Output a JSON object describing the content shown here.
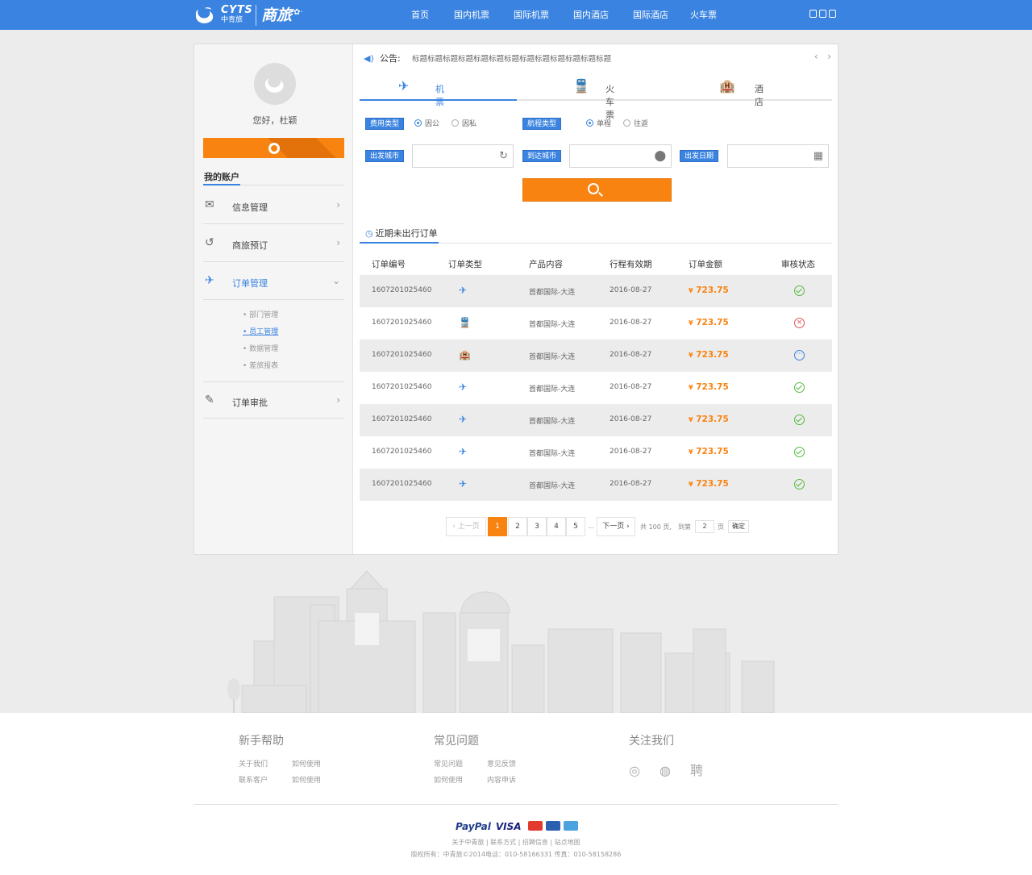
{
  "header": {
    "brand": "CYTS",
    "brand_cn": "中青旅",
    "logo_script": "商旅",
    "nav": [
      "首页",
      "国内机票",
      "国际机票",
      "国内酒店",
      "国际酒店",
      "火车票"
    ]
  },
  "sidebar": {
    "greeting": "您好，杜颖",
    "account_title": "我的账户",
    "items": [
      {
        "label": "信息管理",
        "icon": "mail-icon"
      },
      {
        "label": "商旅预订",
        "icon": "history-icon"
      },
      {
        "label": "订单管理",
        "icon": "plane-icon"
      },
      {
        "label": "订单审批",
        "icon": "edit-icon"
      }
    ],
    "submenu": [
      "部门管理",
      "员工管理",
      "数据管理",
      "差旅报表"
    ]
  },
  "notice": {
    "label": "公告:",
    "text": "标题标题标题标题标题标题标题标题标题标题标题标题标题"
  },
  "tabs": [
    "机票",
    "火车票",
    "酒店"
  ],
  "search": {
    "fee_type_label": "费用类型",
    "fee_options": [
      "因公",
      "因私"
    ],
    "trip_type_label": "航程类型",
    "trip_options": [
      "单程",
      "往返"
    ],
    "from_label": "出发城市",
    "to_label": "到达城市",
    "date_label": "出发日期"
  },
  "recent_title": "近期未出行订单",
  "table": {
    "headers": [
      "订单编号",
      "订单类型",
      "产品内容",
      "行程有效期",
      "订单金额",
      "审核状态"
    ],
    "rows": [
      {
        "id": "1607201025460",
        "type": "plane",
        "content": "首都国际-大连",
        "date": "2016-08-27",
        "amount": "723.75",
        "status": "approved"
      },
      {
        "id": "1607201025460",
        "type": "train",
        "content": "首都国际-大连",
        "date": "2016-08-27",
        "amount": "723.75",
        "status": "rejected"
      },
      {
        "id": "1607201025460",
        "type": "hotel",
        "content": "首都国际-大连",
        "date": "2016-08-27",
        "amount": "723.75",
        "status": "pending"
      },
      {
        "id": "1607201025460",
        "type": "plane",
        "content": "首都国际-大连",
        "date": "2016-08-27",
        "amount": "723.75",
        "status": "approved"
      },
      {
        "id": "1607201025460",
        "type": "plane",
        "content": "首都国际-大连",
        "date": "2016-08-27",
        "amount": "723.75",
        "status": "approved"
      },
      {
        "id": "1607201025460",
        "type": "plane",
        "content": "首都国际-大连",
        "date": "2016-08-27",
        "amount": "723.75",
        "status": "approved"
      },
      {
        "id": "1607201025460",
        "type": "plane",
        "content": "首都国际-大连",
        "date": "2016-08-27",
        "amount": "723.75",
        "status": "approved"
      }
    ],
    "currency": "¥"
  },
  "pagination": {
    "prev": "‹ 上一页",
    "pages": [
      "1",
      "2",
      "3",
      "4",
      "5"
    ],
    "current": "1",
    "ellipsis": "...",
    "next": "下一页 ›",
    "total": "共 100 页,",
    "goto": "到第",
    "goto_value": "2",
    "page_unit": "页",
    "confirm": "确定"
  },
  "footer": {
    "cols": [
      {
        "title": "新手帮助",
        "links": [
          "关于我们",
          "如何使用",
          "联系客户",
          "如何使用"
        ]
      },
      {
        "title": "常见问题",
        "links": [
          "常见问题",
          "意见反馈",
          "如何使用",
          "内容申诉"
        ]
      },
      {
        "title": "关注我们",
        "links": []
      }
    ],
    "follow_icons": [
      "weibo-icon",
      "wechat-icon",
      "recruit-icon"
    ],
    "recruit_char": "聘",
    "payment": [
      "PayPal",
      "VISA"
    ],
    "links_line": "关于中青旅 | 联系方式 | 招聘信息 | 站点地图",
    "copyright": "版权所有：中青旅©2014电话：010-58166331 传真：010-58158286"
  },
  "colors": {
    "accent": "#3a83e0",
    "orange": "#f98310",
    "approved": "#55b93f",
    "rejected": "#e05555"
  }
}
